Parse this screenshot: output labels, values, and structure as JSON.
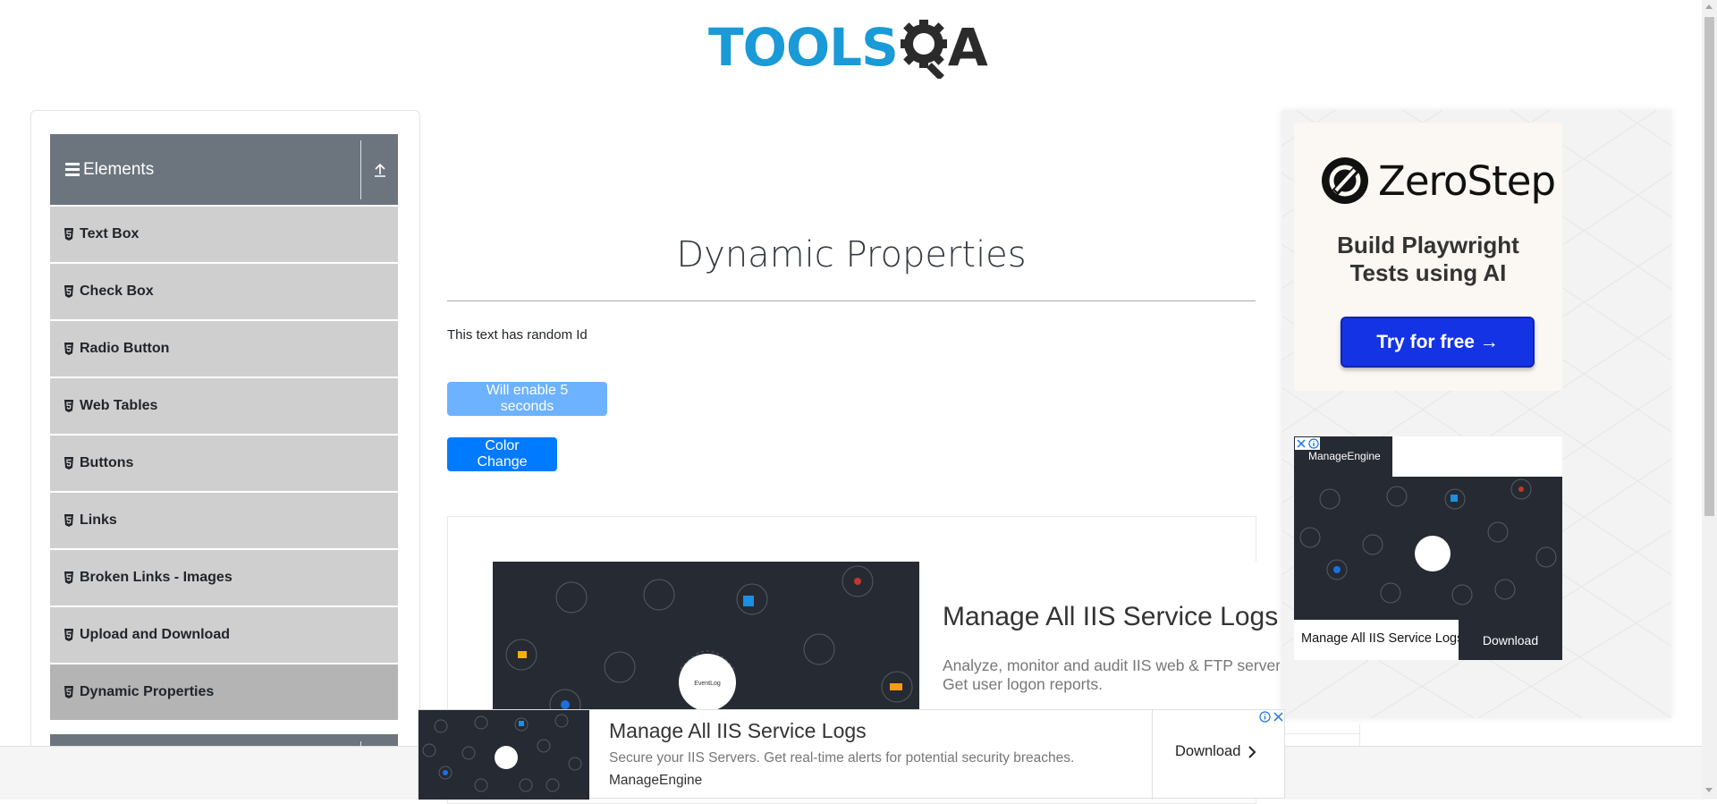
{
  "header": {
    "logo_text": "TOOLSQA",
    "logo_primary": "TOOLS",
    "logo_secondary": "A"
  },
  "sidebar": {
    "group": {
      "title": "Elements",
      "toggle_icon": "upload-arrow-icon"
    },
    "items": [
      {
        "label": "Text Box"
      },
      {
        "label": "Check Box"
      },
      {
        "label": "Radio Button"
      },
      {
        "label": "Web Tables"
      },
      {
        "label": "Buttons"
      },
      {
        "label": "Links"
      },
      {
        "label": "Broken Links - Images"
      },
      {
        "label": "Upload and Download"
      },
      {
        "label": "Dynamic Properties",
        "active": true
      }
    ]
  },
  "main": {
    "title": "Dynamic Properties",
    "random_text": "This text has random Id",
    "enable_button": "Will enable 5 seconds",
    "color_button": "Color Change"
  },
  "big_ad": {
    "title": "Manage All IIS Service Logs",
    "desc_line1": "Analyze, monitor and audit IIS web & FTP server",
    "desc_line2": "Get user logon reports."
  },
  "bottom_ad": {
    "title": "Manage All IIS Service Logs",
    "desc": "Secure your IIS Servers. Get real-time alerts for potential security breaches.",
    "brand": "ManageEngine",
    "cta": "Download"
  },
  "right_ad": {
    "brand": "ZeroStep",
    "tagline_line1": "Build Playwright",
    "tagline_line2": "Tests using AI",
    "cta": "Try for free →"
  },
  "me_ad": {
    "brand": "ManageEngine",
    "title": "Manage All IIS Service Logs",
    "cta": "Download"
  },
  "colors": {
    "primary": "#007bff",
    "primary_disabled": "#6cb2ff",
    "sidebar_header": "#6c757d",
    "sidebar_item": "#cfcfcf",
    "sidebar_item_active": "#b4b4b4",
    "logo_blue": "#1a9ad6",
    "zerostep_button": "#1433e4"
  }
}
